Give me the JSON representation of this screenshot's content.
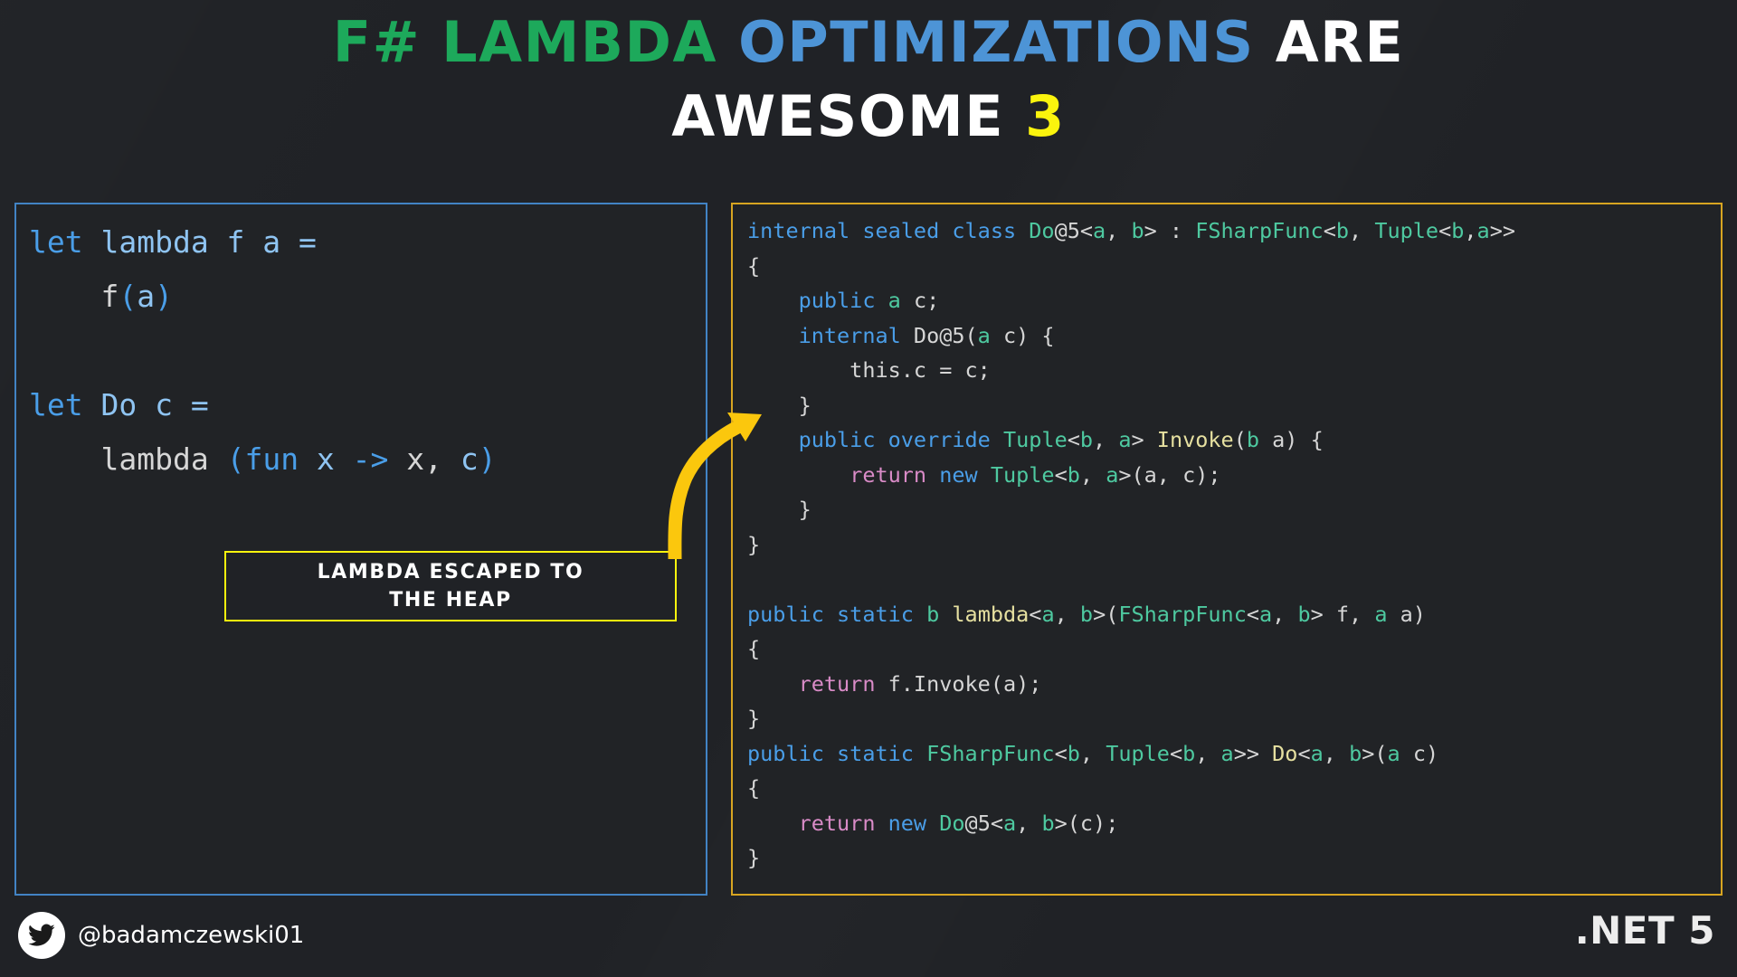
{
  "title": {
    "line1_part1": "F# LAMBDA",
    "line1_part2": "OPTIMIZATIONS",
    "line1_part3": "ARE",
    "line2_part1": "AWESOME",
    "line2_part2": "3",
    "color_green": "#1DA95B",
    "color_blue": "#4D94D6",
    "color_white": "#FFFFFF",
    "color_yellow": "#FBF40D"
  },
  "left_panel": {
    "border_color": "#4283C4",
    "language": "F#",
    "lines": [
      {
        "tokens": [
          {
            "t": "let",
            "c": "fs-kw"
          },
          {
            "t": " lambda f a =",
            "c": "fs-id"
          }
        ]
      },
      {
        "tokens": [
          {
            "t": "    ",
            "c": "fs-pl"
          },
          {
            "t": "f",
            "c": "fs-pl"
          },
          {
            "t": "(",
            "c": "fs-op"
          },
          {
            "t": "a",
            "c": "fs-id"
          },
          {
            "t": ")",
            "c": "fs-op"
          }
        ]
      },
      {
        "tokens": [
          {
            "t": "",
            "c": "fs-pl"
          }
        ]
      },
      {
        "tokens": [
          {
            "t": "let",
            "c": "fs-kw"
          },
          {
            "t": " Do c =",
            "c": "fs-id"
          }
        ]
      },
      {
        "tokens": [
          {
            "t": "    ",
            "c": "fs-pl"
          },
          {
            "t": "lambda",
            "c": "fs-pl"
          },
          {
            "t": " ",
            "c": "fs-pl"
          },
          {
            "t": "(",
            "c": "fs-op"
          },
          {
            "t": "fun",
            "c": "fs-op"
          },
          {
            "t": " x ",
            "c": "fs-id"
          },
          {
            "t": "->",
            "c": "fs-op"
          },
          {
            "t": " x, ",
            "c": "fs-pl"
          },
          {
            "t": "c",
            "c": "fs-id"
          },
          {
            "t": ")",
            "c": "fs-op"
          }
        ]
      }
    ]
  },
  "callout": {
    "line1": "LAMBDA ESCAPED TO",
    "line2": "THE HEAP",
    "border_color": "#FBF40D",
    "text_color": "#FFFFFF"
  },
  "arrow": {
    "color": "#FBC70D",
    "direction": "up-right"
  },
  "right_panel": {
    "border_color": "#D8A521",
    "language": "C#",
    "lines": [
      {
        "tokens": [
          {
            "t": "internal sealed class ",
            "c": "cs-kw"
          },
          {
            "t": "Do",
            "c": "cs-type"
          },
          {
            "t": "@5",
            "c": "cs-pl"
          },
          {
            "t": "<",
            "c": "cs-pl"
          },
          {
            "t": "a",
            "c": "cs-type"
          },
          {
            "t": ", ",
            "c": "cs-pl"
          },
          {
            "t": "b",
            "c": "cs-type"
          },
          {
            "t": "> : ",
            "c": "cs-pl"
          },
          {
            "t": "FSharpFunc",
            "c": "cs-type"
          },
          {
            "t": "<",
            "c": "cs-pl"
          },
          {
            "t": "b",
            "c": "cs-type"
          },
          {
            "t": ", ",
            "c": "cs-pl"
          },
          {
            "t": "Tuple",
            "c": "cs-type"
          },
          {
            "t": "<",
            "c": "cs-pl"
          },
          {
            "t": "b",
            "c": "cs-type"
          },
          {
            "t": ",",
            "c": "cs-pl"
          },
          {
            "t": "a",
            "c": "cs-type"
          },
          {
            "t": ">>",
            "c": "cs-pl"
          }
        ]
      },
      {
        "tokens": [
          {
            "t": "{",
            "c": "cs-pl"
          }
        ]
      },
      {
        "tokens": [
          {
            "t": "    ",
            "c": "cs-pl"
          },
          {
            "t": "public",
            "c": "cs-kw"
          },
          {
            "t": " ",
            "c": "cs-pl"
          },
          {
            "t": "a",
            "c": "cs-type"
          },
          {
            "t": " c;",
            "c": "cs-pl"
          }
        ]
      },
      {
        "tokens": [
          {
            "t": "    ",
            "c": "cs-pl"
          },
          {
            "t": "internal",
            "c": "cs-kw"
          },
          {
            "t": " Do@5(",
            "c": "cs-pl"
          },
          {
            "t": "a",
            "c": "cs-type"
          },
          {
            "t": " c) {",
            "c": "cs-pl"
          }
        ]
      },
      {
        "tokens": [
          {
            "t": "        this.c = c;",
            "c": "cs-pl"
          }
        ]
      },
      {
        "tokens": [
          {
            "t": "    }",
            "c": "cs-pl"
          }
        ]
      },
      {
        "tokens": [
          {
            "t": "    ",
            "c": "cs-pl"
          },
          {
            "t": "public override",
            "c": "cs-kw"
          },
          {
            "t": " ",
            "c": "cs-pl"
          },
          {
            "t": "Tuple",
            "c": "cs-type"
          },
          {
            "t": "<",
            "c": "cs-pl"
          },
          {
            "t": "b",
            "c": "cs-type"
          },
          {
            "t": ", ",
            "c": "cs-pl"
          },
          {
            "t": "a",
            "c": "cs-type"
          },
          {
            "t": "> ",
            "c": "cs-pl"
          },
          {
            "t": "Invoke",
            "c": "cs-fn"
          },
          {
            "t": "(",
            "c": "cs-pl"
          },
          {
            "t": "b",
            "c": "cs-type"
          },
          {
            "t": " a) {",
            "c": "cs-pl"
          }
        ]
      },
      {
        "tokens": [
          {
            "t": "        ",
            "c": "cs-pl"
          },
          {
            "t": "return",
            "c": "cs-ctl"
          },
          {
            "t": " ",
            "c": "cs-pl"
          },
          {
            "t": "new",
            "c": "cs-kw"
          },
          {
            "t": " ",
            "c": "cs-pl"
          },
          {
            "t": "Tuple",
            "c": "cs-type"
          },
          {
            "t": "<",
            "c": "cs-pl"
          },
          {
            "t": "b",
            "c": "cs-type"
          },
          {
            "t": ", ",
            "c": "cs-pl"
          },
          {
            "t": "a",
            "c": "cs-type"
          },
          {
            "t": ">(a, c);",
            "c": "cs-pl"
          }
        ]
      },
      {
        "tokens": [
          {
            "t": "    }",
            "c": "cs-pl"
          }
        ]
      },
      {
        "tokens": [
          {
            "t": "}",
            "c": "cs-pl"
          }
        ]
      },
      {
        "tokens": [
          {
            "t": "",
            "c": "cs-pl"
          }
        ]
      },
      {
        "tokens": [
          {
            "t": "public static",
            "c": "cs-kw"
          },
          {
            "t": " ",
            "c": "cs-pl"
          },
          {
            "t": "b",
            "c": "cs-type"
          },
          {
            "t": " ",
            "c": "cs-pl"
          },
          {
            "t": "lambda",
            "c": "cs-fn"
          },
          {
            "t": "<",
            "c": "cs-pl"
          },
          {
            "t": "a",
            "c": "cs-type"
          },
          {
            "t": ", ",
            "c": "cs-pl"
          },
          {
            "t": "b",
            "c": "cs-type"
          },
          {
            "t": ">(",
            "c": "cs-pl"
          },
          {
            "t": "FSharpFunc",
            "c": "cs-type"
          },
          {
            "t": "<",
            "c": "cs-pl"
          },
          {
            "t": "a",
            "c": "cs-type"
          },
          {
            "t": ", ",
            "c": "cs-pl"
          },
          {
            "t": "b",
            "c": "cs-type"
          },
          {
            "t": "> f, ",
            "c": "cs-pl"
          },
          {
            "t": "a",
            "c": "cs-type"
          },
          {
            "t": " a)",
            "c": "cs-pl"
          }
        ]
      },
      {
        "tokens": [
          {
            "t": "{",
            "c": "cs-pl"
          }
        ]
      },
      {
        "tokens": [
          {
            "t": "    ",
            "c": "cs-pl"
          },
          {
            "t": "return",
            "c": "cs-ctl"
          },
          {
            "t": " f.Invoke(a);",
            "c": "cs-pl"
          }
        ]
      },
      {
        "tokens": [
          {
            "t": "}",
            "c": "cs-pl"
          }
        ]
      },
      {
        "tokens": [
          {
            "t": "public static",
            "c": "cs-kw"
          },
          {
            "t": " ",
            "c": "cs-pl"
          },
          {
            "t": "FSharpFunc",
            "c": "cs-type"
          },
          {
            "t": "<",
            "c": "cs-pl"
          },
          {
            "t": "b",
            "c": "cs-type"
          },
          {
            "t": ", ",
            "c": "cs-pl"
          },
          {
            "t": "Tuple",
            "c": "cs-type"
          },
          {
            "t": "<",
            "c": "cs-pl"
          },
          {
            "t": "b",
            "c": "cs-type"
          },
          {
            "t": ", ",
            "c": "cs-pl"
          },
          {
            "t": "a",
            "c": "cs-type"
          },
          {
            "t": ">> ",
            "c": "cs-pl"
          },
          {
            "t": "Do",
            "c": "cs-fn"
          },
          {
            "t": "<",
            "c": "cs-pl"
          },
          {
            "t": "a",
            "c": "cs-type"
          },
          {
            "t": ", ",
            "c": "cs-pl"
          },
          {
            "t": "b",
            "c": "cs-type"
          },
          {
            "t": ">(",
            "c": "cs-pl"
          },
          {
            "t": "a",
            "c": "cs-type"
          },
          {
            "t": " c)",
            "c": "cs-pl"
          }
        ]
      },
      {
        "tokens": [
          {
            "t": "{",
            "c": "cs-pl"
          }
        ]
      },
      {
        "tokens": [
          {
            "t": "    ",
            "c": "cs-pl"
          },
          {
            "t": "return",
            "c": "cs-ctl"
          },
          {
            "t": " ",
            "c": "cs-pl"
          },
          {
            "t": "new",
            "c": "cs-kw"
          },
          {
            "t": " ",
            "c": "cs-pl"
          },
          {
            "t": "Do",
            "c": "cs-type"
          },
          {
            "t": "@5<",
            "c": "cs-pl"
          },
          {
            "t": "a",
            "c": "cs-type"
          },
          {
            "t": ", ",
            "c": "cs-pl"
          },
          {
            "t": "b",
            "c": "cs-type"
          },
          {
            "t": ">(c);",
            "c": "cs-pl"
          }
        ]
      },
      {
        "tokens": [
          {
            "t": "}",
            "c": "cs-pl"
          }
        ]
      }
    ]
  },
  "footer": {
    "twitter_handle": "@badamczewski01",
    "platform_label": ".NET 5"
  }
}
